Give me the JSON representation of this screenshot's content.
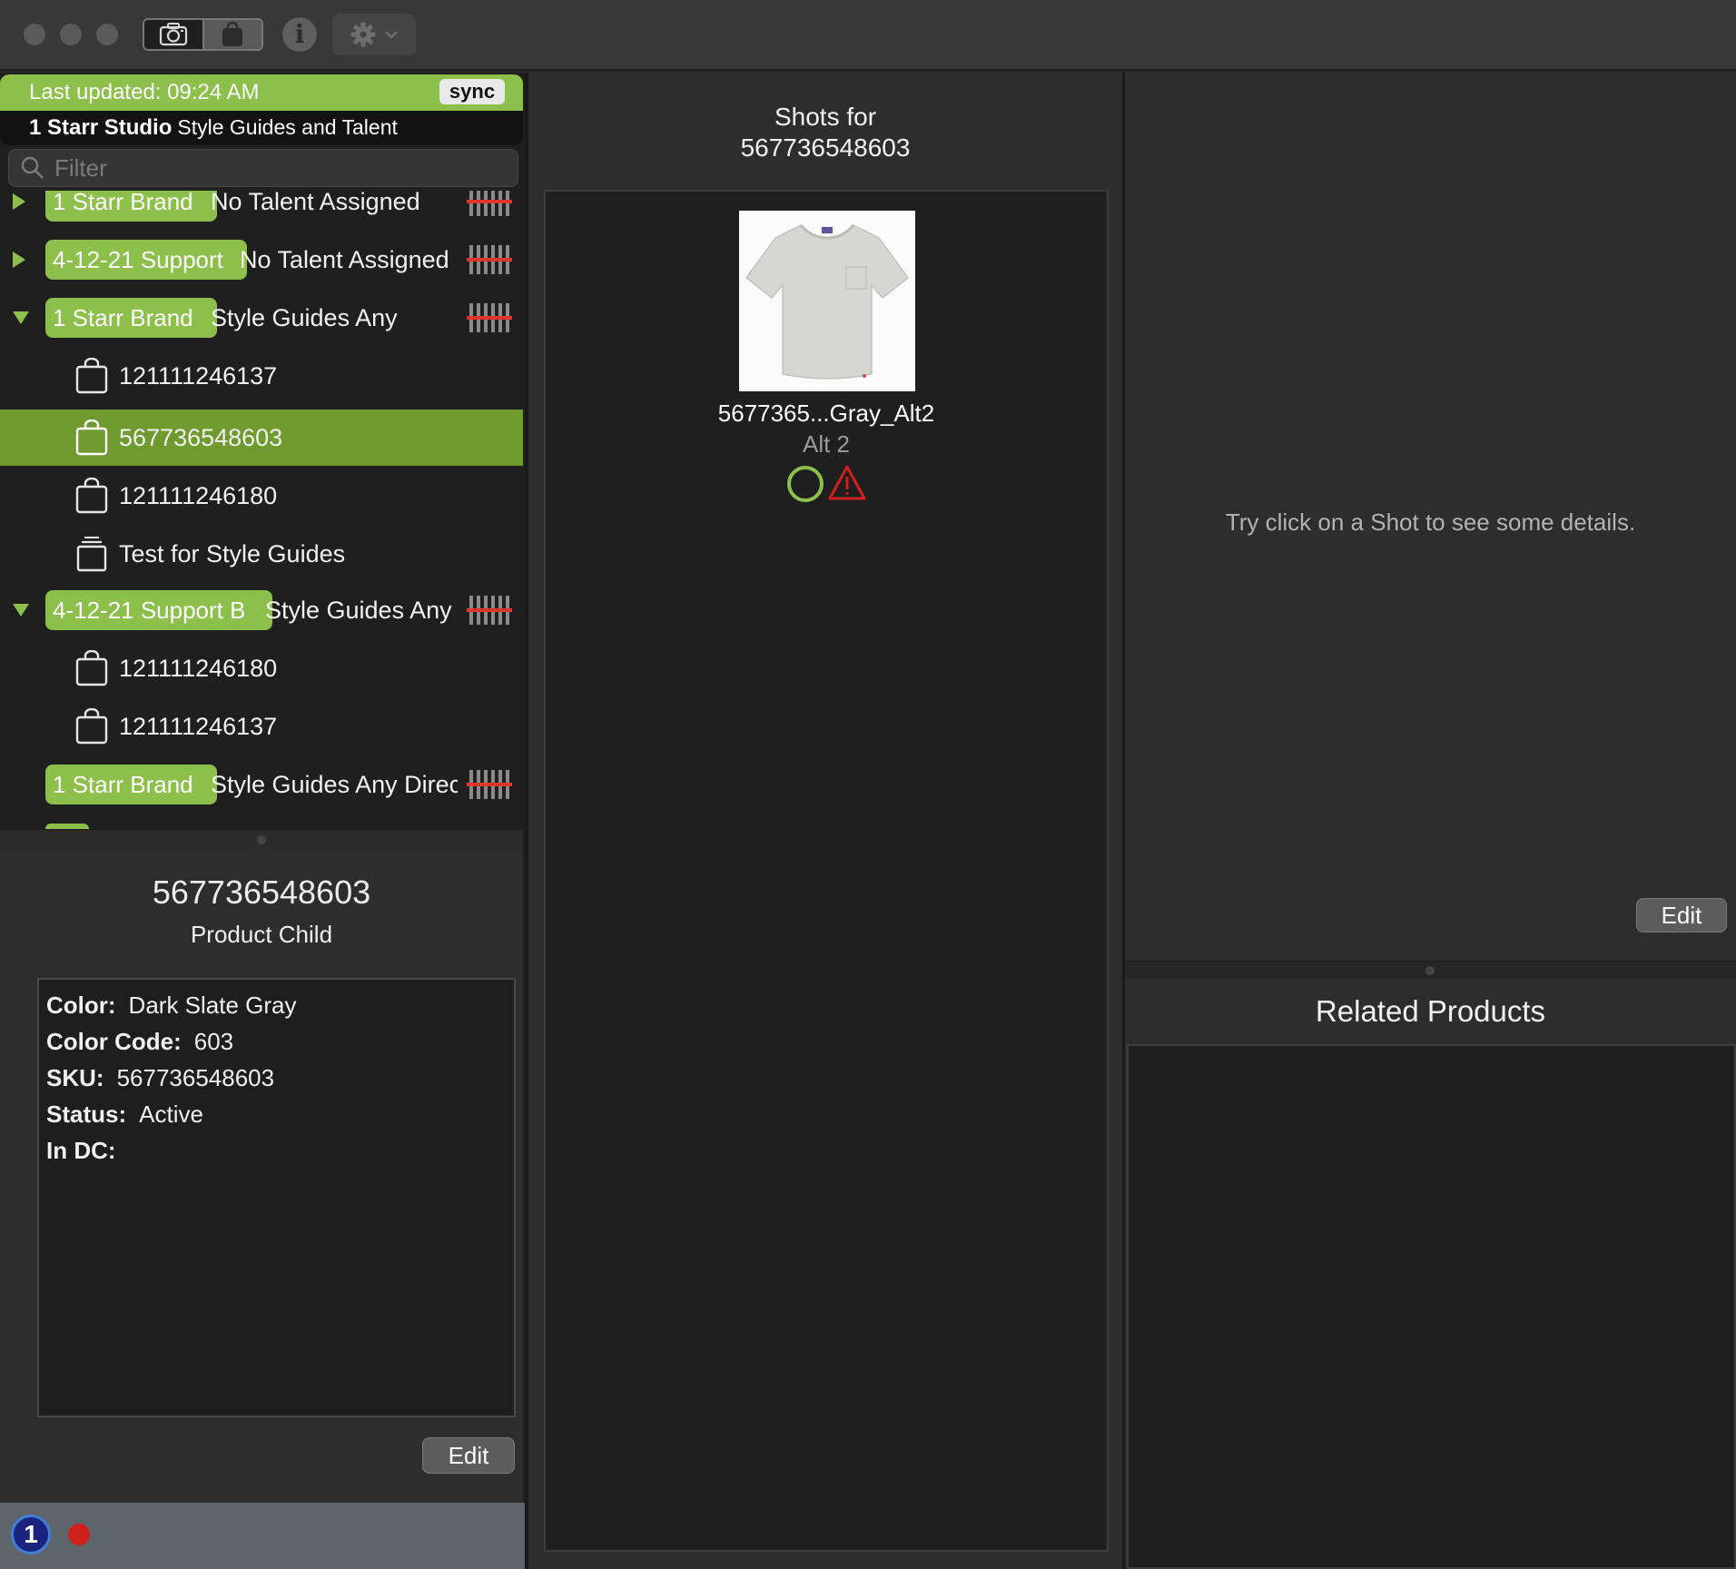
{
  "sync": {
    "last_updated": "Last updated: 09:24 AM",
    "button": "sync"
  },
  "studio": {
    "name": "1 Starr Studio",
    "subtitle": "Style Guides and Talent"
  },
  "filter": {
    "placeholder": "Filter"
  },
  "tree": {
    "rows": [
      {
        "pill": "1 Starr Brand",
        "label": "No Talent Assigned"
      },
      {
        "pill": "4-12-21 Support",
        "label": "No Talent Assigned"
      },
      {
        "pill": "1 Starr Brand",
        "label": "Style Guides Any"
      },
      {
        "label": "121111246137"
      },
      {
        "label": "567736548603"
      },
      {
        "label": "121111246180"
      },
      {
        "label": "Test for Style Guides"
      },
      {
        "pill": "4-12-21 Support B",
        "label": "Style Guides Any"
      },
      {
        "label": "121111246180"
      },
      {
        "label": "121111246137"
      },
      {
        "pill": "1 Starr Brand",
        "label": "Style Guides Any Direc"
      }
    ]
  },
  "detail": {
    "title": "567736548603",
    "subtitle": "Product Child",
    "fields": [
      {
        "key": "Color:",
        "value": "Dark Slate Gray"
      },
      {
        "key": "Color Code:",
        "value": "603"
      },
      {
        "key": "SKU:",
        "value": "567736548603"
      },
      {
        "key": "Status:",
        "value": "Active"
      },
      {
        "key": "In DC:",
        "value": ""
      }
    ],
    "edit_label": "Edit"
  },
  "status_bar": {
    "app_badge": "1"
  },
  "shots": {
    "header_line1": "Shots for",
    "header_line2": "567736548603",
    "items": [
      {
        "name": "5677365...Gray_Alt2",
        "alt": "Alt 2"
      }
    ]
  },
  "details_pane": {
    "hint": "Try click on a Shot to see some details.",
    "edit_label": "Edit"
  },
  "related": {
    "title": "Related Products"
  },
  "colors": {
    "accent_green": "#8dc04a",
    "selected_row": "#6f9a2e",
    "warning_red": "#d0201c"
  }
}
